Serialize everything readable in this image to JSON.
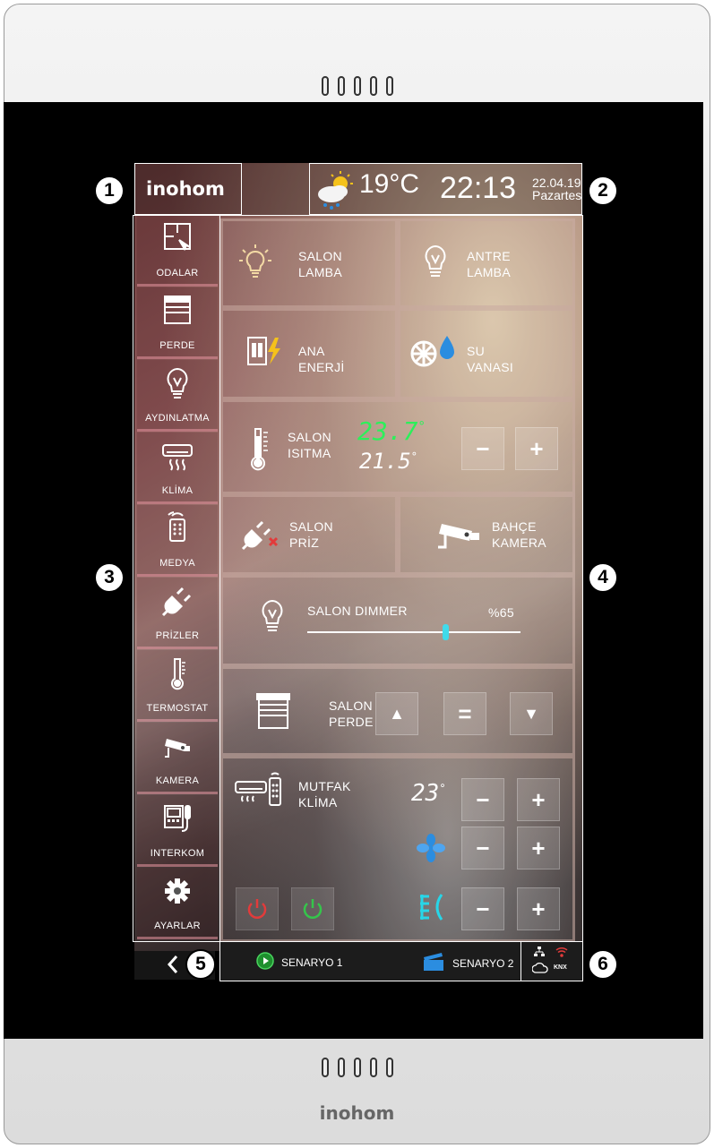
{
  "brand": "inohom",
  "weather": {
    "icon": "partly-cloudy-rain-icon",
    "temperature": "19°C"
  },
  "clock": {
    "time": "22:13",
    "date": "22.04.19",
    "weekday": "Pazartesi"
  },
  "sidebar": {
    "items": [
      {
        "label": "ODALAR",
        "icon": "rooms-icon"
      },
      {
        "label": "PERDE",
        "icon": "curtain-icon"
      },
      {
        "label": "AYDINLATMA",
        "icon": "bulb-icon"
      },
      {
        "label": "KLİMA",
        "icon": "air-conditioner-icon"
      },
      {
        "label": "MEDYA",
        "icon": "remote-icon"
      },
      {
        "label": "PRİZLER",
        "icon": "plug-icon"
      },
      {
        "label": "TERMOSTAT",
        "icon": "thermometer-icon"
      },
      {
        "label": "KAMERA",
        "icon": "camera-icon"
      },
      {
        "label": "INTERKOM",
        "icon": "intercom-icon"
      },
      {
        "label": "AYARLAR",
        "icon": "gear-icon"
      }
    ]
  },
  "tiles": {
    "salon_lamba": "SALON\nLAMBA",
    "antre_lamba": "ANTRE\nLAMBA",
    "ana_enerji": "ANA\nENERJİ",
    "su_vanasi": "SU\nVANASI",
    "salon_isitma": {
      "title": "SALON\nISITMA",
      "current": "23.7",
      "set": "21.5",
      "minus": "−",
      "plus": "+"
    },
    "salon_priz": "SALON\nPRİZ",
    "bahce_kamera": "BAHÇE\nKAMERA",
    "salon_dimmer": {
      "title": "SALON DIMMER",
      "value_label": "%65",
      "level": 0.65
    },
    "salon_perde": {
      "title": "SALON\nPERDE",
      "up": "▲",
      "stop": "=",
      "down": "▼"
    },
    "mutfak_klima": {
      "title": "MUTFAK\nKLİMA",
      "setpoint": "23",
      "minus": "−",
      "plus": "+"
    }
  },
  "scenarios": [
    {
      "label": "SENARYO 1"
    },
    {
      "label": "SENARYO 2"
    }
  ],
  "status": {
    "knx": "KNX"
  },
  "callouts": [
    "1",
    "2",
    "3",
    "4",
    "5",
    "6"
  ],
  "colors": {
    "lcd_green": "#2cf05a",
    "power_off": "#e23b3b",
    "power_on": "#35c54b",
    "accent_cyan": "#27d6e8"
  }
}
